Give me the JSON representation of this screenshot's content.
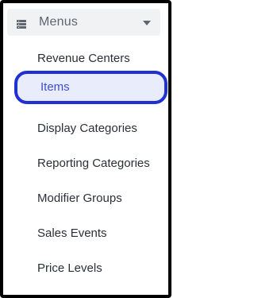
{
  "menu": {
    "header_label": "Menus",
    "header_icon": "list-icon",
    "caret_icon": "caret-down-icon",
    "items": [
      {
        "label": "Revenue Centers",
        "active": false
      },
      {
        "label": "Items",
        "active": true
      },
      {
        "label": "Display Categories",
        "active": false
      },
      {
        "label": "Reporting Categories",
        "active": false
      },
      {
        "label": "Modifier Groups",
        "active": false
      },
      {
        "label": "Sales Events",
        "active": false
      },
      {
        "label": "Price Levels",
        "active": false
      }
    ]
  },
  "colors": {
    "header_bg": "#f1f2f4",
    "active_border": "#1f31d4",
    "active_bg": "#e9ecfb",
    "active_text": "#3d4fd6",
    "item_text": "#2b2f36"
  }
}
